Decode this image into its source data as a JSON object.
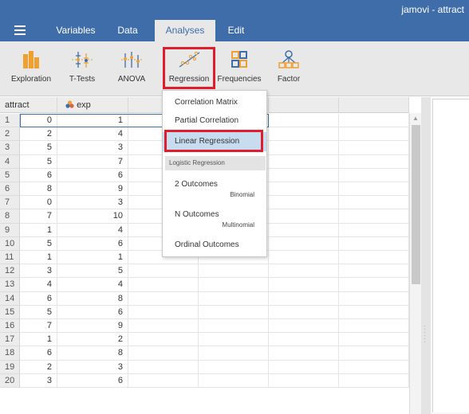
{
  "window": {
    "title": "jamovi - attract"
  },
  "tabs": [
    "Variables",
    "Data",
    "Analyses",
    "Edit"
  ],
  "active_tab": "Analyses",
  "ribbon": [
    "Exploration",
    "T-Tests",
    "ANOVA",
    "Regression",
    "Frequencies",
    "Factor"
  ],
  "columns": [
    "attract",
    "exp"
  ],
  "rows": [
    [
      "1",
      "0",
      "1"
    ],
    [
      "2",
      "2",
      "4"
    ],
    [
      "3",
      "5",
      "3"
    ],
    [
      "4",
      "5",
      "7"
    ],
    [
      "5",
      "6",
      "6"
    ],
    [
      "6",
      "8",
      "9"
    ],
    [
      "7",
      "0",
      "3"
    ],
    [
      "8",
      "7",
      "10"
    ],
    [
      "9",
      "1",
      "4"
    ],
    [
      "10",
      "5",
      "6"
    ],
    [
      "11",
      "1",
      "1"
    ],
    [
      "12",
      "3",
      "5"
    ],
    [
      "13",
      "4",
      "4"
    ],
    [
      "14",
      "6",
      "8"
    ],
    [
      "15",
      "5",
      "6"
    ],
    [
      "16",
      "7",
      "9"
    ],
    [
      "17",
      "1",
      "2"
    ],
    [
      "18",
      "6",
      "8"
    ],
    [
      "19",
      "2",
      "3"
    ],
    [
      "20",
      "3",
      "6"
    ]
  ],
  "menu": {
    "correlation_matrix": "Correlation Matrix",
    "partial_correlation": "Partial Correlation",
    "linear_regression": "Linear Regression",
    "logistic_group": "Logistic Regression",
    "two_outcomes": "2 Outcomes",
    "two_outcomes_sub": "Binomial",
    "n_outcomes": "N Outcomes",
    "n_outcomes_sub": "Multinomial",
    "ordinal_outcomes": "Ordinal Outcomes"
  },
  "colors": {
    "brand": "#3e6da9",
    "highlight_box": "#e11c2c",
    "menu_selected": "#c8dcf0"
  }
}
